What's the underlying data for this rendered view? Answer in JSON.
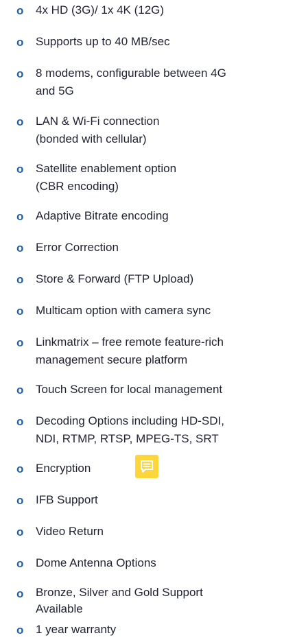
{
  "features": [
    {
      "lines": [
        "4x HD (3G)/ 1x 4K (12G)"
      ]
    },
    {
      "lines": [
        "Supports up to 40 MB/sec"
      ]
    },
    {
      "lines": [
        "8 modems, configurable between 4G",
        "and 5G"
      ]
    },
    {
      "lines": [
        "LAN & Wi-Fi connection",
        "(bonded with cellular)"
      ]
    },
    {
      "lines": [
        "Satellite enablement option",
        "(CBR encoding)"
      ]
    },
    {
      "lines": [
        "Adaptive Bitrate encoding"
      ]
    },
    {
      "lines": [
        "Error Correction"
      ]
    },
    {
      "lines": [
        "Store & Forward (FTP Upload)"
      ]
    },
    {
      "lines": [
        "Multicam option with camera sync"
      ]
    },
    {
      "lines": [
        "Linkmatrix – free remote feature-rich",
        "management secure platform"
      ]
    },
    {
      "lines": [
        "Touch Screen for local management"
      ]
    },
    {
      "lines": [
        "Decoding Options including HD-SDI,",
        "NDI, RTMP, RTSP, MPEG-TS, SRT"
      ]
    },
    {
      "lines": [
        "Encryption"
      ]
    },
    {
      "lines": [
        "IFB Support"
      ]
    },
    {
      "lines": [
        "Video Return"
      ]
    },
    {
      "lines": [
        "Dome Antenna Options"
      ]
    },
    {
      "lines": [
        "Bronze, Silver and Gold Support",
        "Available"
      ]
    },
    {
      "lines": [
        "1 year warranty"
      ]
    }
  ],
  "bullet_glyph": "o",
  "colors": {
    "bullet": "#1a5fb4",
    "text": "#1f2233",
    "note_icon_bg": "#fcd63a"
  },
  "icons": {
    "comment": "comment-icon"
  }
}
